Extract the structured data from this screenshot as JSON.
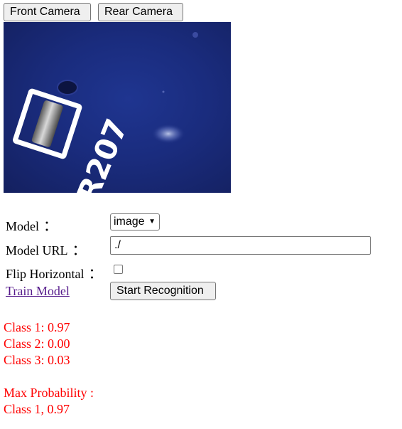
{
  "camera_buttons": {
    "front": "Front Camera",
    "rear": "Rear Camera"
  },
  "camera_view": {
    "board_label": "R207"
  },
  "form": {
    "model_label": "Model",
    "model_selected": "image",
    "model_url_label": "Model URL",
    "model_url_value": "./",
    "flip_label": "Flip Horizontal",
    "flip_checked": false,
    "colon": "：",
    "train_link": "Train Model",
    "start_button": "Start Recognition"
  },
  "results": {
    "classes": [
      "Class 1: 0.97",
      "Class 2: 0.00",
      "Class 3: 0.03"
    ],
    "max_label": "Max Probability :",
    "max_value": "Class 1, 0.97"
  },
  "colors": {
    "result_text": "#ff0000",
    "link_visited": "#551a8b"
  }
}
